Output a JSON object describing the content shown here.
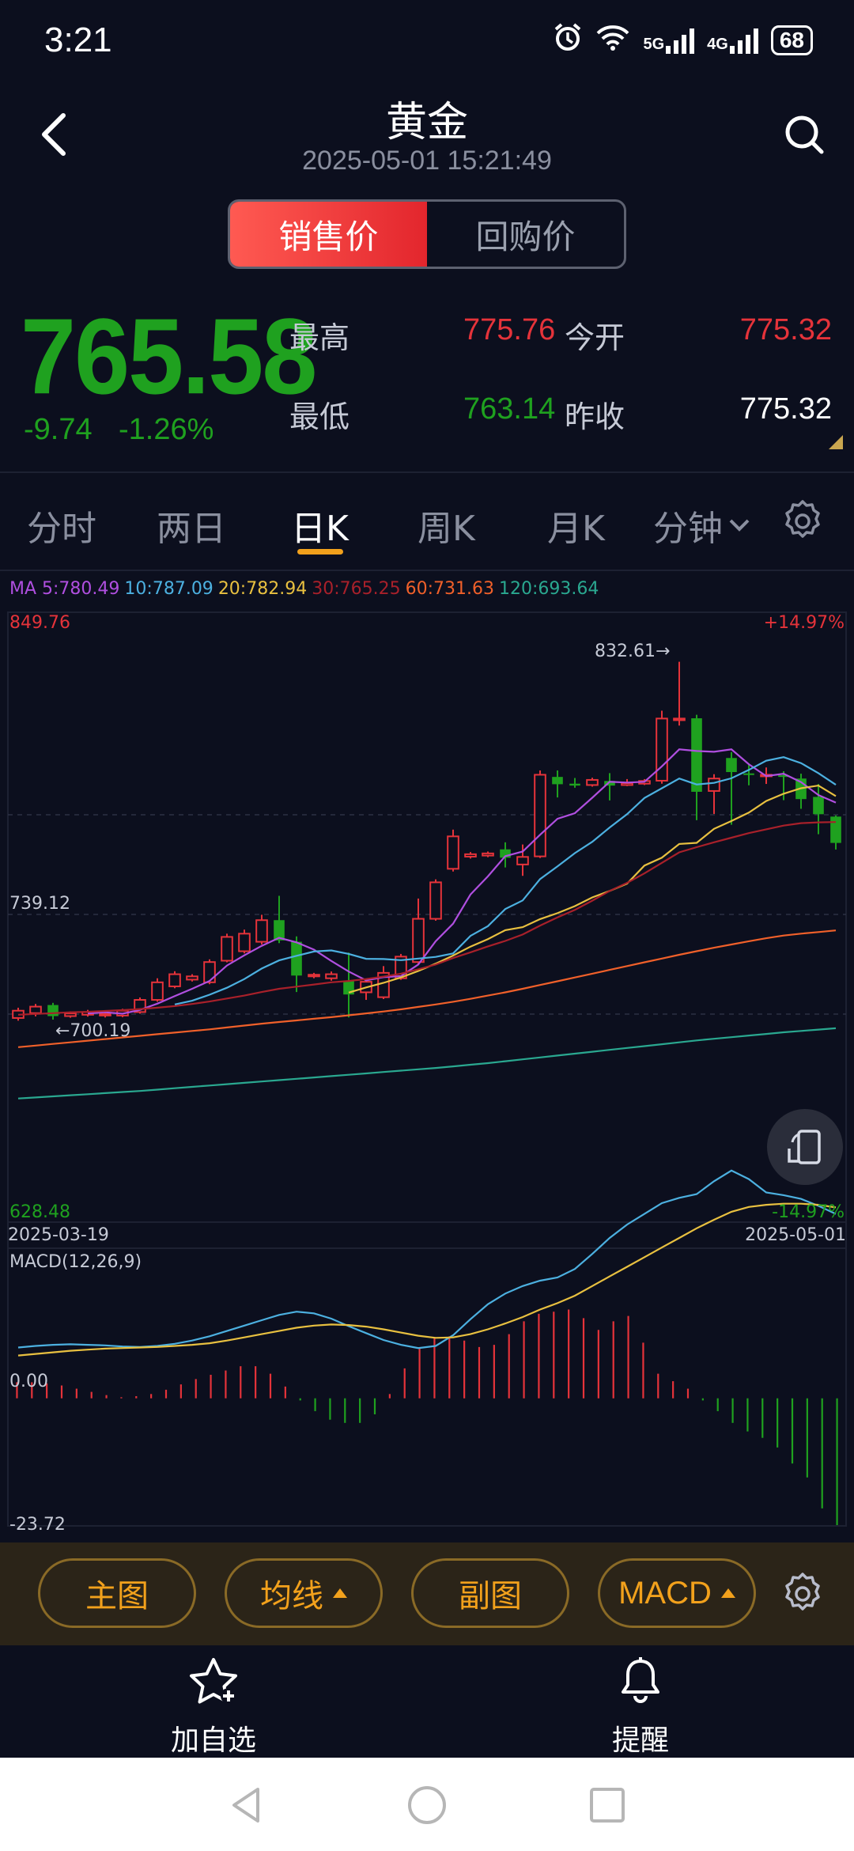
{
  "status": {
    "time": "3:21",
    "net1": "5G",
    "net2": "4G",
    "battery": "68"
  },
  "header": {
    "title": "黄金",
    "datetime": "2025-05-01 15:21:49"
  },
  "toggle": {
    "sell": "销售价",
    "buyback": "回购价"
  },
  "quote": {
    "price": "765.58",
    "change": "-9.74",
    "change_pct": "-1.26%",
    "high_label": "最高",
    "high": "775.76",
    "open_label": "今开",
    "open": "775.32",
    "low_label": "最低",
    "low": "763.14",
    "prev_close_label": "昨收",
    "prev_close": "775.32"
  },
  "period_tabs": [
    "分时",
    "两日",
    "日K",
    "周K",
    "月K",
    "分钟"
  ],
  "ma_legend": [
    {
      "text": "MA 5:780.49",
      "color": "#b04fe0"
    },
    {
      "text": "10:787.09",
      "color": "#4cb0e0"
    },
    {
      "text": "20:782.94",
      "color": "#e8c040"
    },
    {
      "text": "30:765.25",
      "color": "#a8202a"
    },
    {
      "text": "60:731.63",
      "color": "#f0602a"
    },
    {
      "text": "120:693.64",
      "color": "#2aa890"
    }
  ],
  "chart_data": {
    "type": "candlestick",
    "y_max_label": "849.76",
    "y_mid_label": "739.12",
    "y_min_label": "628.48",
    "y_max_pct": "+14.97%",
    "y_min_pct": "-14.97%",
    "ylim": [
      628.48,
      849.76
    ],
    "date_start": "2025-03-19",
    "date_end": "2025-05-01",
    "high_annotation": "832.61→",
    "low_annotation": "←700.19",
    "candles": [
      {
        "o": 700.8,
        "c": 703.5,
        "h": 704.6,
        "l": 699.8
      },
      {
        "o": 702.6,
        "c": 705.0,
        "h": 706.0,
        "l": 701.4
      },
      {
        "o": 705.6,
        "c": 701.5,
        "h": 706.4,
        "l": 700.19
      },
      {
        "o": 701.5,
        "c": 702.5,
        "h": 703.2,
        "l": 700.9
      },
      {
        "o": 702.0,
        "c": 703.0,
        "h": 703.8,
        "l": 701.3
      },
      {
        "o": 701.8,
        "c": 702.3,
        "h": 703.0,
        "l": 701.0
      },
      {
        "o": 701.7,
        "c": 703.5,
        "h": 704.2,
        "l": 701.1
      },
      {
        "o": 703.0,
        "c": 707.5,
        "h": 708.4,
        "l": 702.4
      },
      {
        "o": 707.5,
        "c": 714.0,
        "h": 715.5,
        "l": 706.8
      },
      {
        "o": 712.5,
        "c": 717.0,
        "h": 718.1,
        "l": 711.8
      },
      {
        "o": 715.0,
        "c": 716.2,
        "h": 717.0,
        "l": 714.3
      },
      {
        "o": 714.0,
        "c": 721.5,
        "h": 722.5,
        "l": 713.3
      },
      {
        "o": 722.0,
        "c": 730.8,
        "h": 732.0,
        "l": 721.4
      },
      {
        "o": 725.5,
        "c": 732.0,
        "h": 733.5,
        "l": 724.7
      },
      {
        "o": 729.0,
        "c": 737.0,
        "h": 739.0,
        "l": 728.0
      },
      {
        "o": 737.0,
        "c": 729.5,
        "h": 746.0,
        "l": 728.5
      },
      {
        "o": 729.0,
        "c": 716.5,
        "h": 731.0,
        "l": 710.4
      },
      {
        "o": 716.2,
        "c": 716.8,
        "h": 717.5,
        "l": 715.5
      },
      {
        "o": 715.5,
        "c": 717.0,
        "h": 718.0,
        "l": 714.6
      },
      {
        "o": 714.4,
        "c": 709.5,
        "h": 725.0,
        "l": 701.0
      },
      {
        "o": 710.3,
        "c": 714.2,
        "h": 715.2,
        "l": 707.5
      },
      {
        "o": 708.5,
        "c": 717.5,
        "h": 720.0,
        "l": 707.8
      },
      {
        "o": 715.5,
        "c": 723.5,
        "h": 724.5,
        "l": 714.9
      },
      {
        "o": 721.5,
        "c": 737.5,
        "h": 745.0,
        "l": 720.7
      },
      {
        "o": 737.5,
        "c": 751.0,
        "h": 752.1,
        "l": 736.8
      },
      {
        "o": 756.0,
        "c": 768.0,
        "h": 770.5,
        "l": 755.0
      },
      {
        "o": 760.5,
        "c": 761.4,
        "h": 762.2,
        "l": 759.8
      },
      {
        "o": 760.9,
        "c": 761.7,
        "h": 762.4,
        "l": 760.3
      },
      {
        "o": 763.2,
        "c": 760.1,
        "h": 765.8,
        "l": 756.5
      },
      {
        "o": 757.6,
        "c": 760.4,
        "h": 765.0,
        "l": 753.4
      },
      {
        "o": 760.6,
        "c": 790.8,
        "h": 792.4,
        "l": 760.0
      },
      {
        "o": 790.0,
        "c": 787.3,
        "h": 792.4,
        "l": 782.4
      },
      {
        "o": 787.5,
        "c": 786.8,
        "h": 789.6,
        "l": 786.0
      },
      {
        "o": 787.0,
        "c": 788.9,
        "h": 789.7,
        "l": 786.4
      },
      {
        "o": 788.5,
        "c": 786.8,
        "h": 791.4,
        "l": 781.3
      },
      {
        "o": 787.0,
        "c": 787.7,
        "h": 789.2,
        "l": 786.6
      },
      {
        "o": 787.5,
        "c": 788.5,
        "h": 789.2,
        "l": 787.0
      },
      {
        "o": 788.6,
        "c": 811.6,
        "h": 814.5,
        "l": 787.5
      },
      {
        "o": 811.0,
        "c": 811.6,
        "h": 832.61,
        "l": 809.0
      },
      {
        "o": 811.7,
        "c": 784.5,
        "h": 813.0,
        "l": 774.0
      },
      {
        "o": 784.8,
        "c": 789.4,
        "h": 791.0,
        "l": 776.3
      },
      {
        "o": 797.0,
        "c": 791.8,
        "h": 799.2,
        "l": 772.3
      },
      {
        "o": 791.3,
        "c": 791.0,
        "h": 794.4,
        "l": 786.9
      },
      {
        "o": 790.4,
        "c": 790.8,
        "h": 793.5,
        "l": 787.4
      },
      {
        "o": 790.6,
        "c": 790.0,
        "h": 792.1,
        "l": 781.4
      },
      {
        "o": 789.4,
        "c": 781.8,
        "h": 791.2,
        "l": 778.2
      },
      {
        "o": 782.6,
        "c": 776.2,
        "h": 787.4,
        "l": 768.8
      },
      {
        "o": 775.32,
        "c": 765.58,
        "h": 775.76,
        "l": 763.14
      }
    ],
    "ma_series": {
      "ma5": [
        null,
        null,
        null,
        null,
        702.5,
        702.9,
        702.4,
        703.8,
        706.1,
        708.9,
        711.6,
        714.5,
        720.2,
        724.0,
        727.5,
        730.5,
        728.8,
        726.1,
        721.9,
        718.0,
        714.7,
        715.9,
        716.3,
        720.6,
        729.2,
        735.7,
        746.5,
        753.2,
        760.7,
        762.4,
        768.6,
        774.5,
        776.6,
        782.3,
        788.2,
        787.9,
        788.2,
        793.9,
        800.2,
        799.6,
        799.3,
        800.2,
        794.7,
        790.3,
        791.2,
        788.1,
        783.3,
        780.5
      ],
      "ma10": [
        null,
        null,
        null,
        null,
        null,
        null,
        null,
        null,
        null,
        705.8,
        707.2,
        709.4,
        712.0,
        715.2,
        719.1,
        722.1,
        723.8,
        725.4,
        725.8,
        724.5,
        722.7,
        722.6,
        722.2,
        722.8,
        723.4,
        724.7,
        731.2,
        734.8,
        741.1,
        744.3,
        752.2,
        756.9,
        761.8,
        766.0,
        771.3,
        776.2,
        782.2,
        785.8,
        789.4,
        787.2,
        787.8,
        789.5,
        792.6,
        796.0,
        797.3,
        795.1,
        791.4,
        787.1
      ],
      "ma20": [
        null,
        null,
        null,
        null,
        null,
        null,
        null,
        null,
        null,
        null,
        null,
        null,
        null,
        null,
        null,
        null,
        null,
        null,
        null,
        710.2,
        712.1,
        713.8,
        715.8,
        718.2,
        720.9,
        723.9,
        727.2,
        730.0,
        733.3,
        734.4,
        737.4,
        739.6,
        742.2,
        745.4,
        747.8,
        750.5,
        757.2,
        760.1,
        765.2,
        765.6,
        770.8,
        773.7,
        776.8,
        781.1,
        783.8,
        785.8,
        786.8,
        782.9
      ],
      "ma30": [
        702.0,
        702.3,
        702.6,
        702.9,
        703.1,
        703.4,
        703.7,
        704.1,
        704.6,
        705.2,
        706.0,
        706.9,
        708.0,
        709.1,
        710.4,
        711.6,
        712.4,
        713.2,
        714.0,
        714.5,
        715.2,
        716.1,
        717.2,
        718.8,
        720.6,
        723.0,
        725.1,
        727.3,
        729.3,
        731.7,
        735.0,
        738.0,
        740.8,
        744.2,
        747.8,
        750.8,
        754.3,
        758.2,
        762.1,
        764.0,
        765.8,
        767.5,
        769.2,
        770.6,
        772.0,
        772.9,
        773.2,
        773.3
      ],
      "ma60": [
        690.0,
        690.6,
        691.2,
        691.8,
        692.4,
        693.0,
        693.6,
        694.2,
        694.8,
        695.4,
        696.0,
        696.6,
        697.3,
        698.0,
        698.7,
        699.3,
        699.9,
        700.5,
        701.1,
        701.8,
        702.5,
        703.2,
        704.0,
        704.9,
        705.8,
        706.8,
        707.9,
        709.1,
        710.3,
        711.6,
        713.0,
        714.4,
        715.8,
        717.2,
        718.6,
        720.0,
        721.4,
        722.8,
        724.2,
        725.5,
        726.8,
        728.0,
        729.2,
        730.3,
        731.3,
        732.0,
        732.6,
        733.2
      ],
      "ma120": [
        671.0,
        671.4,
        671.8,
        672.2,
        672.6,
        673.0,
        673.4,
        673.8,
        674.3,
        674.8,
        675.3,
        675.8,
        676.3,
        676.8,
        677.3,
        677.8,
        678.3,
        678.8,
        679.3,
        679.8,
        680.3,
        680.8,
        681.3,
        681.8,
        682.3,
        682.9,
        683.5,
        684.1,
        684.8,
        685.5,
        686.2,
        686.9,
        687.6,
        688.3,
        689.0,
        689.7,
        690.4,
        691.1,
        691.8,
        692.5,
        693.1,
        693.7,
        694.3,
        694.9,
        695.5,
        696.0,
        696.5,
        697.0
      ]
    },
    "macd": {
      "label": "MACD(12,26,9)",
      "y_top_label": "0.00",
      "y_bottom_label": "-23.72",
      "ylim": [
        -23.72,
        26
      ],
      "dif": [
        9.5,
        9.8,
        10.0,
        10.1,
        10.0,
        9.9,
        9.7,
        9.6,
        9.8,
        10.2,
        10.8,
        11.6,
        12.6,
        13.6,
        14.6,
        15.6,
        16.2,
        15.9,
        14.9,
        13.5,
        12.2,
        10.9,
        10.0,
        9.4,
        9.8,
        11.8,
        14.8,
        17.6,
        19.6,
        21.0,
        22.0,
        22.6,
        24.2,
        27.0,
        30.0,
        32.5,
        34.5,
        36.5,
        37.5,
        38.2,
        40.6,
        42.6,
        41.0,
        38.5,
        38.0,
        37.3,
        36.0,
        34.5
      ],
      "dea": [
        8.0,
        8.3,
        8.6,
        8.9,
        9.1,
        9.3,
        9.4,
        9.5,
        9.6,
        9.8,
        10.0,
        10.3,
        10.8,
        11.4,
        12.0,
        12.6,
        13.2,
        13.6,
        13.8,
        13.7,
        13.4,
        12.9,
        12.3,
        11.7,
        11.3,
        11.4,
        12.0,
        12.9,
        14.0,
        15.2,
        16.6,
        17.8,
        19.2,
        21.0,
        22.8,
        24.6,
        26.4,
        28.2,
        30.0,
        31.8,
        33.4,
        34.9,
        35.8,
        36.2,
        36.4,
        36.4,
        36.2,
        35.7
      ],
      "hist": [
        3.0,
        3.0,
        2.8,
        2.4,
        1.8,
        1.2,
        0.6,
        0.2,
        0.4,
        0.8,
        1.6,
        2.6,
        3.6,
        4.4,
        5.2,
        6.0,
        6.0,
        4.6,
        2.2,
        -0.4,
        -2.4,
        -4.0,
        -4.6,
        -4.6,
        -3.0,
        0.8,
        5.6,
        9.4,
        11.2,
        11.6,
        10.8,
        9.6,
        10.0,
        12.0,
        14.4,
        15.8,
        16.2,
        16.6,
        15.0,
        12.8,
        14.4,
        15.4,
        10.4,
        4.6,
        3.2,
        1.8,
        -0.4,
        -2.4,
        -4.6,
        -6.2,
        -7.4,
        -9.2,
        -12.2,
        -14.8,
        -20.6,
        -23.72
      ]
    }
  },
  "toolbar": {
    "main": "主图",
    "ma": "均线",
    "sub": "副图",
    "macd": "MACD"
  },
  "actions": {
    "watchlist": "加自选",
    "alert": "提醒"
  }
}
